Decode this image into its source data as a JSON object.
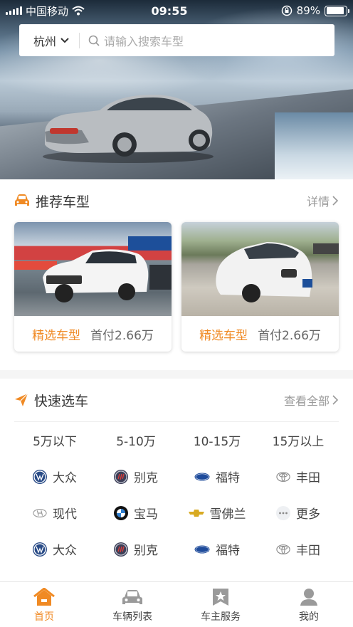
{
  "status_bar": {
    "carrier": "中国移动",
    "time": "09:55",
    "battery": "89%",
    "battery_level": 0.89
  },
  "search": {
    "city": "杭州",
    "placeholder": "请输入搜索车型"
  },
  "recommended": {
    "title": "推荐车型",
    "more_label": "详情",
    "cards": [
      {
        "tag": "精选车型",
        "price": "首付2.66万"
      },
      {
        "tag": "精选车型",
        "price": "首付2.66万"
      }
    ]
  },
  "quick_select": {
    "title": "快速选车",
    "more_label": "查看全部",
    "price_ranges": [
      "5万以下",
      "5-10万",
      "10-15万",
      "15万以上"
    ],
    "brand_rows": [
      [
        {
          "name": "大众",
          "icon": "vw-logo-icon"
        },
        {
          "name": "别克",
          "icon": "buick-logo-icon"
        },
        {
          "name": "福特",
          "icon": "ford-logo-icon"
        },
        {
          "name": "丰田",
          "icon": "toyota-logo-icon"
        }
      ],
      [
        {
          "name": "现代",
          "icon": "hyundai-logo-icon"
        },
        {
          "name": "宝马",
          "icon": "bmw-logo-icon"
        },
        {
          "name": "雪佛兰",
          "icon": "chevrolet-logo-icon"
        },
        {
          "name": "更多",
          "icon": "more-dots-icon"
        }
      ],
      [
        {
          "name": "大众",
          "icon": "vw-logo-icon"
        },
        {
          "name": "别克",
          "icon": "buick-logo-icon"
        },
        {
          "name": "福特",
          "icon": "ford-logo-icon"
        },
        {
          "name": "丰田",
          "icon": "toyota-logo-icon"
        }
      ]
    ]
  },
  "tabbar": {
    "tabs": [
      {
        "label": "首页",
        "icon": "home-icon",
        "active": true
      },
      {
        "label": "车辆列表",
        "icon": "car-icon",
        "active": false
      },
      {
        "label": "车主服务",
        "icon": "star-badge-icon",
        "active": false
      },
      {
        "label": "我的",
        "icon": "user-icon",
        "active": false
      }
    ]
  },
  "colors": {
    "accent": "#f08a24",
    "text": "#333333",
    "muted": "#999999",
    "background": "#f5f5f5"
  }
}
